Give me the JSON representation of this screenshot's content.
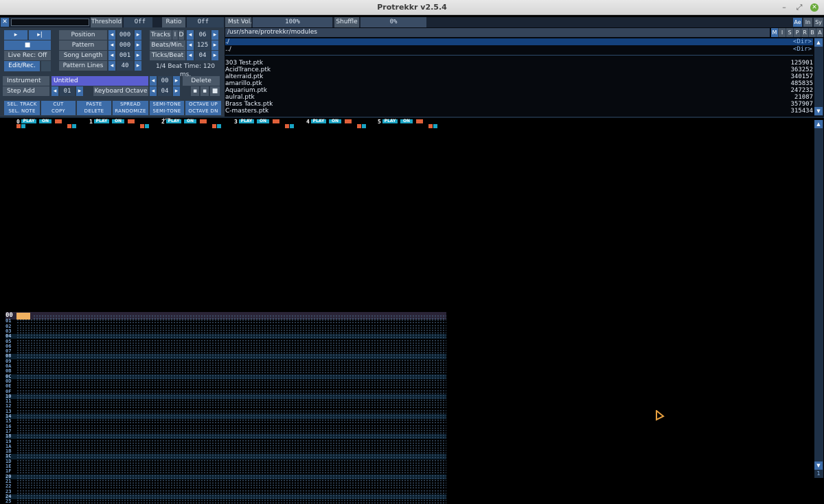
{
  "window": {
    "title": "Protrekkr v2.5.4"
  },
  "top_bar": {
    "threshold_label": "Threshold",
    "threshold_value": "Off",
    "ratio_label": "Ratio",
    "ratio_value": "Off",
    "mst_vol_label": "Mst Vol.",
    "mst_vol_value": "100%",
    "shuffle_label": "Shuffle",
    "shuffle_value": "0%",
    "right_tabs": [
      "Ae",
      "In",
      "Sy"
    ]
  },
  "transport": {
    "live_rec": "Live Rec: Off",
    "edit_rec": "Edit/Rec."
  },
  "song": {
    "position_label": "Position",
    "position_value": "000",
    "pattern_label": "Pattern",
    "pattern_value": "000",
    "song_length_label": "Song Length",
    "song_length_value": "001",
    "pattern_lines_label": "Pattern Lines",
    "pattern_lines_value": "40"
  },
  "tempo": {
    "tracks_label": "Tracks",
    "tracks_i": "I",
    "tracks_d": "D",
    "tracks_value": "06",
    "bpm_label": "Beats/Min.",
    "bpm_value": "125",
    "tpb_label": "Ticks/Beat",
    "tpb_value": "04",
    "beat_time": "1/4 Beat Time: 120 ms."
  },
  "instrument": {
    "label": "Instrument",
    "name": "Untitled",
    "number": "00",
    "delete": "Delete",
    "step_add_label": "Step Add",
    "step_add_value": "01",
    "kbd_octave_label": "Keyboard Octave",
    "kbd_octave_value": "04"
  },
  "edit_buttons": {
    "row1": [
      "SEL. TRACK",
      "CUT",
      "PASTE",
      "SPREAD",
      "SEMI-TONE UP",
      "OCTAVE UP"
    ],
    "row2": [
      "SEL. NOTE",
      "COPY",
      "DELETE",
      "RANDOMIZE",
      "SEMI-TONE DN",
      "OCTAVE DN"
    ]
  },
  "file_browser": {
    "path": "/usr/share/protrekkr/modules",
    "tabs": [
      "M",
      "I",
      "S",
      "P",
      "R",
      "B",
      "A"
    ],
    "dirs": [
      {
        "name": "./",
        "tag": "<Dir>"
      },
      {
        "name": "../",
        "tag": "<Dir>"
      }
    ],
    "files": [
      {
        "name": "303 Test.ptk",
        "size": "125901"
      },
      {
        "name": "AcidTrance.ptk",
        "size": "363252"
      },
      {
        "name": "alterraid.ptk",
        "size": "340157"
      },
      {
        "name": "amarillo.ptk",
        "size": "485835"
      },
      {
        "name": "Aquarium.ptk",
        "size": "247232"
      },
      {
        "name": "aulral.ptk",
        "size": "21087"
      },
      {
        "name": "Brass Tacks.ptk",
        "size": "357907"
      },
      {
        "name": "C-masters.ptk",
        "size": "315434"
      }
    ]
  },
  "tracks": [
    {
      "num": "0",
      "play": "PLAY",
      "on": "ON"
    },
    {
      "num": "1",
      "play": "PLAY",
      "on": "ON"
    },
    {
      "num": "2",
      "play": "PLAY",
      "on": "ON"
    },
    {
      "num": "3",
      "play": "PLAY",
      "on": "ON"
    },
    {
      "num": "4",
      "play": "PLAY",
      "on": "ON"
    },
    {
      "num": "5",
      "play": "PLAY",
      "on": "ON"
    }
  ],
  "pattern_rows": [
    "00",
    "01",
    "02",
    "03",
    "04",
    "05",
    "06",
    "07",
    "08",
    "09",
    "0A",
    "0B",
    "0C",
    "0D",
    "0E",
    "0F",
    "10",
    "11",
    "12",
    "13",
    "14",
    "15",
    "16",
    "17",
    "18",
    "19",
    "1A",
    "1B",
    "1C",
    "1D",
    "1E",
    "1F",
    "20",
    "21",
    "22",
    "23",
    "24",
    "25"
  ],
  "scroll_indicator": "1",
  "colors": {
    "panel": "#2c3948",
    "button": "#3c6ca8",
    "accent": "#19a4c4",
    "cursor": "#f0b060"
  }
}
